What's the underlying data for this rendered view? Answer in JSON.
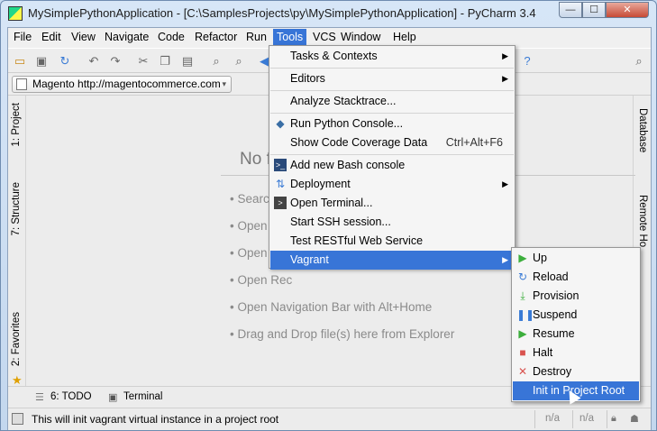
{
  "window": {
    "title": "MySimplePythonApplication - [C:\\SamplesProjects\\py\\MySimplePythonApplication] - PyCharm 3.4",
    "min_label": "—",
    "max_label": "☐",
    "close_label": "✕"
  },
  "menubar": [
    "File",
    "Edit",
    "View",
    "Navigate",
    "Code",
    "Refactor",
    "Run",
    "Tools",
    "VCS",
    "Window",
    "Help"
  ],
  "navbar": {
    "breadcrumb": "Magento http://magentocommerce.com",
    "dropdown": "▾"
  },
  "left_tabs": {
    "project": "1: Project",
    "structure": "7: Structure",
    "favorites": "2: Favorites"
  },
  "right_tabs": {
    "database": "Database",
    "remote": "Remote Ho"
  },
  "editor": {
    "no_files": "No file",
    "hints": [
      "• Search Ev",
      "• Open Pro",
      "• Open a fi",
      "• Open Rec",
      "• Open Navigation Bar with Alt+Home",
      "• Drag and Drop file(s) here from Explorer"
    ]
  },
  "bottom_tabs": {
    "todo": "6: TODO",
    "terminal": "Terminal"
  },
  "status": {
    "message": "This will init vagrant virtual instance in a project root",
    "na1": "n/a",
    "na2": "n/a"
  },
  "tools_menu": [
    {
      "label": "Tasks & Contexts",
      "shortcut": "",
      "submenu": true
    },
    {
      "label": "Editors",
      "shortcut": "",
      "submenu": true
    },
    {
      "label": "Analyze Stacktrace...",
      "shortcut": "",
      "submenu": false
    },
    {
      "label": "Run Python Console...",
      "shortcut": "",
      "submenu": false
    },
    {
      "label": "Show Code Coverage Data",
      "shortcut": "Ctrl+Alt+F6",
      "submenu": false
    },
    {
      "label": "Add new Bash console",
      "shortcut": "",
      "submenu": false
    },
    {
      "label": "Deployment",
      "shortcut": "",
      "submenu": true
    },
    {
      "label": "Open Terminal...",
      "shortcut": "",
      "submenu": false
    },
    {
      "label": "Start SSH session...",
      "shortcut": "",
      "submenu": false
    },
    {
      "label": "Test RESTful Web Service",
      "shortcut": "",
      "submenu": false
    },
    {
      "label": "Vagrant",
      "shortcut": "",
      "submenu": true
    }
  ],
  "vagrant_menu": [
    "Up",
    "Reload",
    "Provision",
    "Suspend",
    "Resume",
    "Halt",
    "Destroy",
    "Init in Project Root"
  ],
  "colors": {
    "selection": "#3875d7",
    "green": "#3cae3c",
    "red": "#d9534f"
  }
}
